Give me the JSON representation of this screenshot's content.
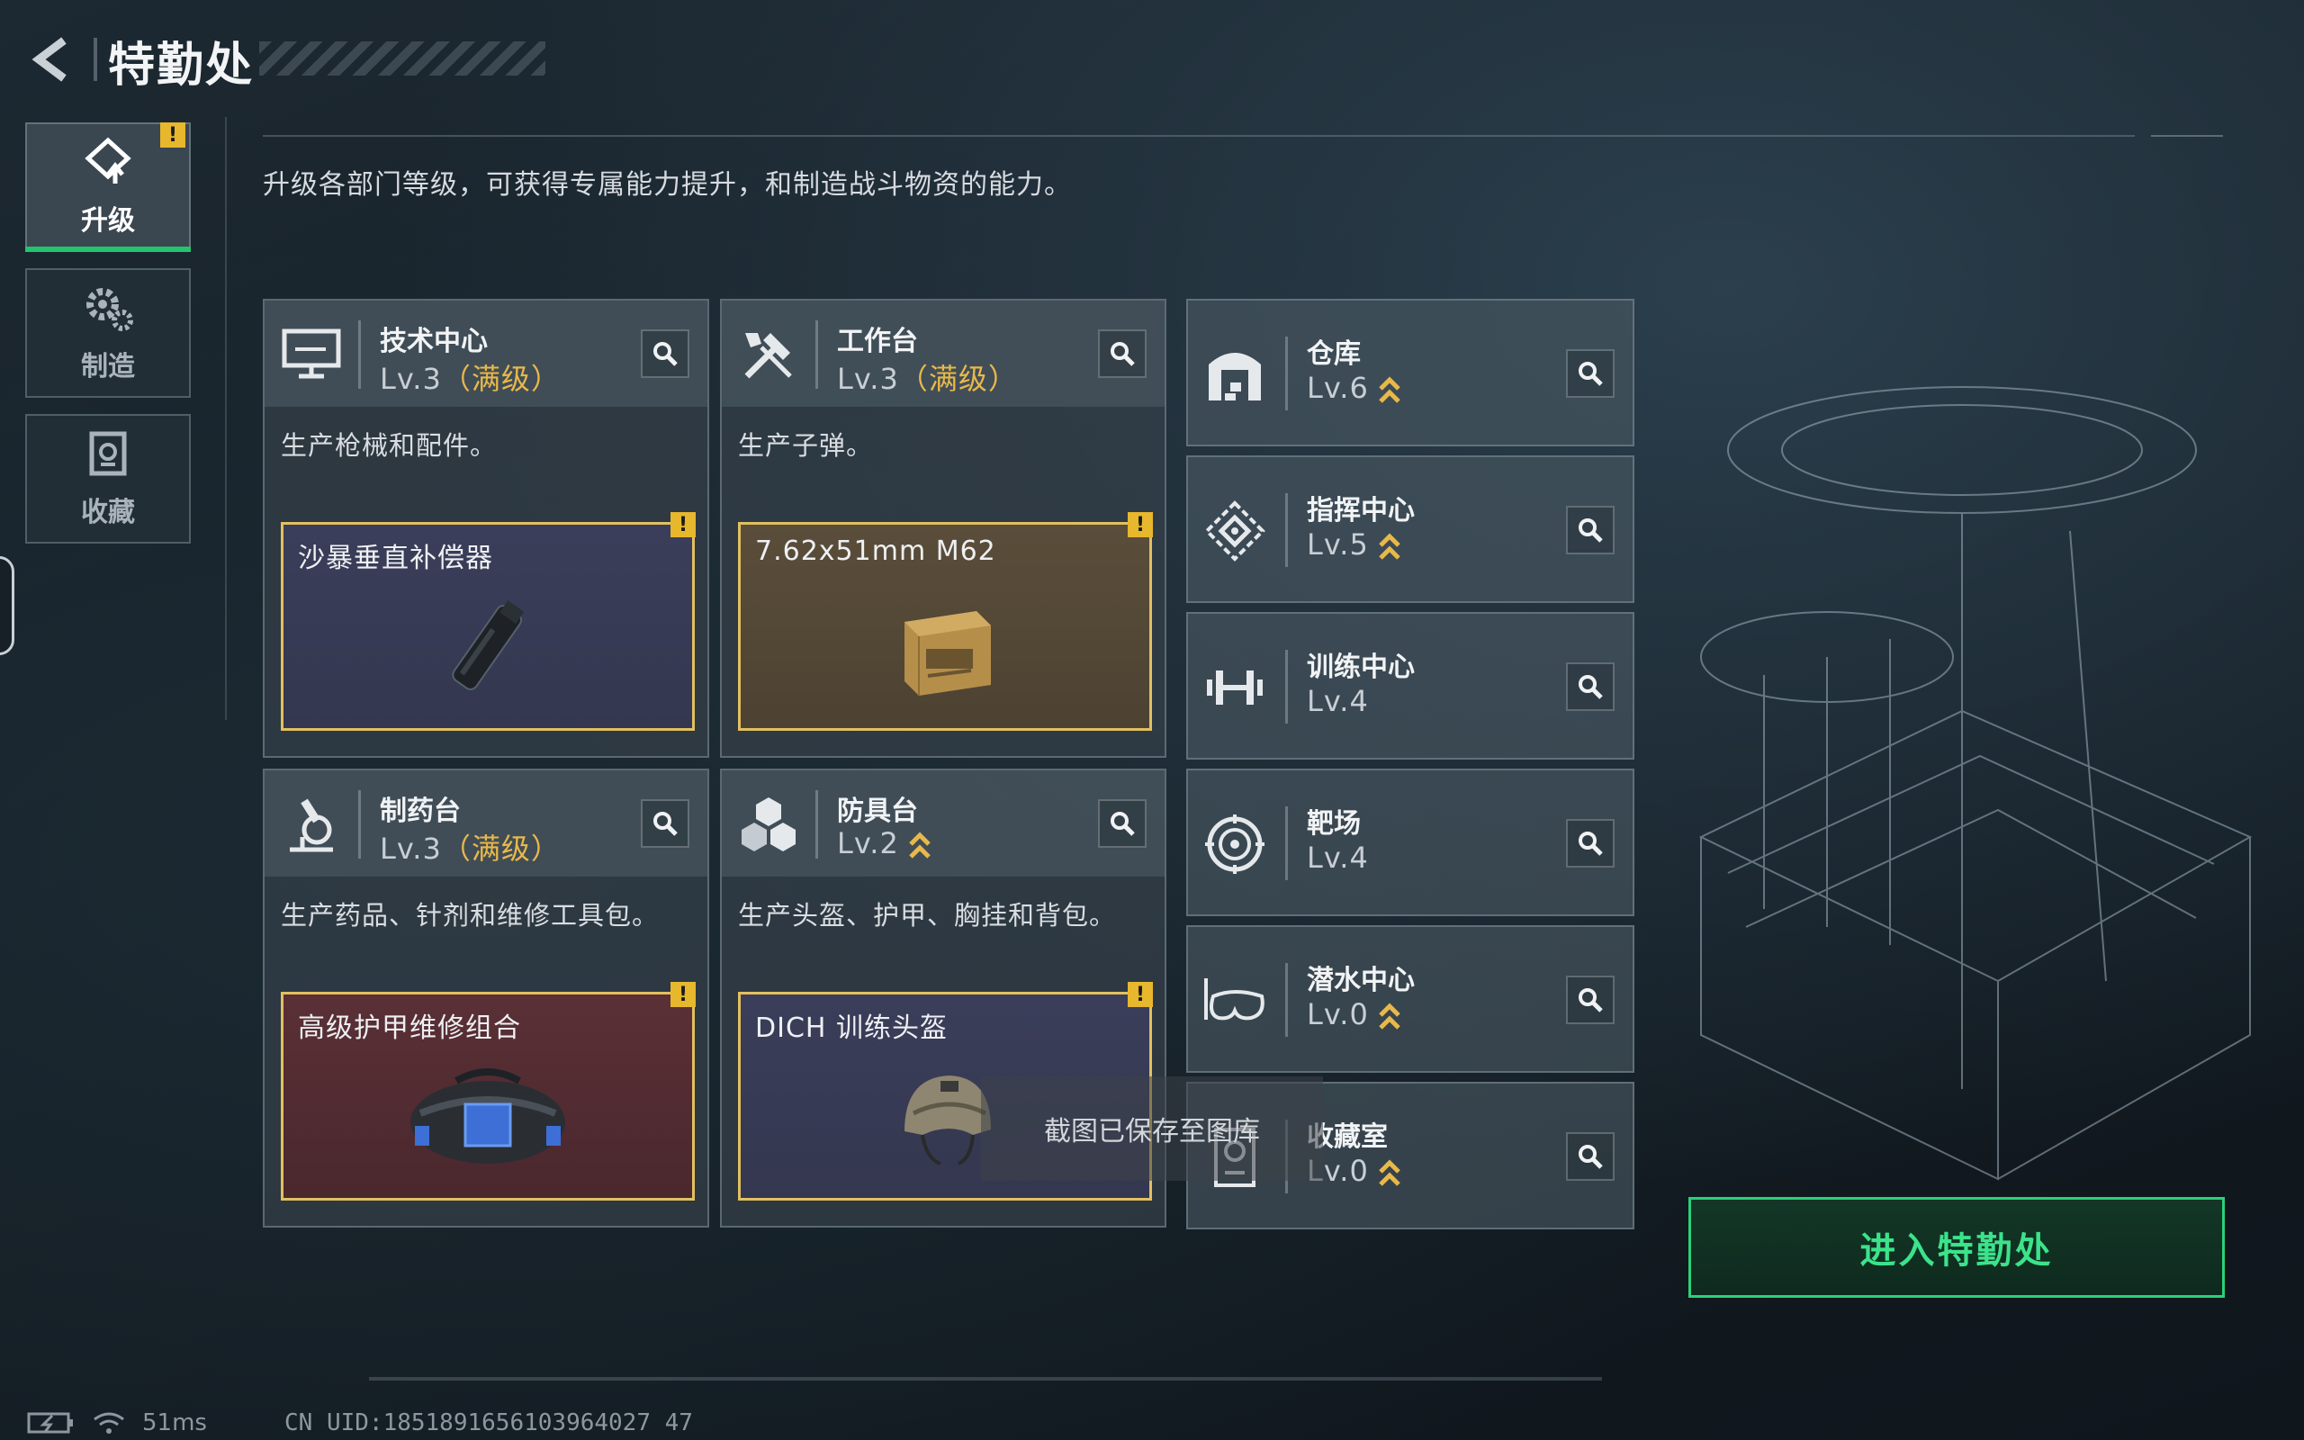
{
  "header": {
    "title": "特勤处"
  },
  "subtitle": "升级各部门等级，可获得专属能力提升，和制造战斗物资的能力。",
  "nav": [
    {
      "label": "升级",
      "icon": "upgrade-icon",
      "active": true
    },
    {
      "label": "制造",
      "icon": "gears-icon",
      "active": false
    },
    {
      "label": "收藏",
      "icon": "collection-icon",
      "active": false
    }
  ],
  "alert_mark": "!",
  "cards": [
    {
      "name": "技术中心",
      "level": "Lv.3",
      "max": "（满级）",
      "desc": "生产枪械和配件。",
      "item": "沙暴垂直补偿器",
      "icon": "monitor-icon"
    },
    {
      "name": "工作台",
      "level": "Lv.3",
      "max": "（满级）",
      "desc": "生产子弹。",
      "item": "7.62x51mm M62",
      "icon": "tools-icon"
    },
    {
      "name": "制药台",
      "level": "Lv.3",
      "max": "（满级）",
      "desc": "生产药品、针剂和维修工具包。",
      "item": "高级护甲维修组合",
      "icon": "microscope-icon"
    },
    {
      "name": "防具台",
      "level": "Lv.2",
      "max": "",
      "desc": "生产头盔、护甲、胸挂和背包。",
      "item": "DICH 训练头盔",
      "icon": "blocks-icon"
    }
  ],
  "rooms": [
    {
      "name": "仓库",
      "level": "Lv.6",
      "upgradable": true,
      "icon": "warehouse-icon"
    },
    {
      "name": "指挥中心",
      "level": "Lv.5",
      "upgradable": true,
      "icon": "command-icon"
    },
    {
      "name": "训练中心",
      "level": "Lv.4",
      "upgradable": false,
      "icon": "dumbbell-icon"
    },
    {
      "name": "靶场",
      "level": "Lv.4",
      "upgradable": false,
      "icon": "target-icon"
    },
    {
      "name": "潜水中心",
      "level": "Lv.0",
      "upgradable": true,
      "icon": "diving-mask-icon"
    },
    {
      "name": "收藏室",
      "level": "Lv.0",
      "upgradable": true,
      "icon": "trophy-icon"
    }
  ],
  "enter_button": "进入特勤处",
  "toast": "截图已保存至图库",
  "status": {
    "ping": "51ms",
    "uid": "CN UID:1851891656103964027 47"
  },
  "colors": {
    "accent_green": "#2bd178",
    "max_gold": "#e8b84a",
    "alert_yellow": "#e7b72d"
  }
}
